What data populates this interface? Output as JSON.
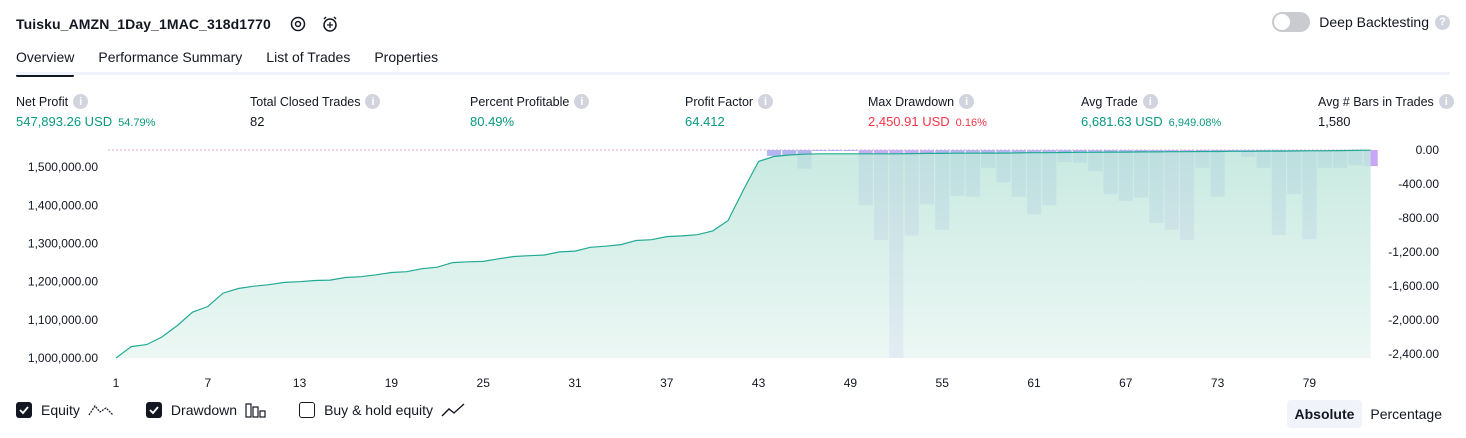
{
  "header": {
    "strategy_title": "Tuisku_AMZN_1Day_1MAC_318d1770",
    "settings_icon": "gear-icon",
    "add_alert_icon": "alarm-plus-icon",
    "deep_backtesting_label": "Deep Backtesting",
    "deep_backtesting_on": false
  },
  "tabs": [
    {
      "label": "Overview",
      "active": true
    },
    {
      "label": "Performance Summary",
      "active": false
    },
    {
      "label": "List of Trades",
      "active": false
    },
    {
      "label": "Properties",
      "active": false
    }
  ],
  "metrics": {
    "net_profit": {
      "label": "Net Profit",
      "value": "547,893.26 USD",
      "pct": "54.79%"
    },
    "total_closed_trades": {
      "label": "Total Closed Trades",
      "value": "82"
    },
    "percent_profitable": {
      "label": "Percent Profitable",
      "value": "80.49%"
    },
    "profit_factor": {
      "label": "Profit Factor",
      "value": "64.412"
    },
    "max_drawdown": {
      "label": "Max Drawdown",
      "value": "2,450.91 USD",
      "pct": "0.16%"
    },
    "avg_trade": {
      "label": "Avg Trade",
      "value": "6,681.63 USD",
      "pct": "6,949.08%"
    },
    "avg_bars": {
      "label": "Avg # Bars in Trades",
      "value": "1,580"
    }
  },
  "chart_data": {
    "type": "area",
    "x_ticks": [
      "1",
      "7",
      "13",
      "19",
      "25",
      "31",
      "37",
      "43",
      "49",
      "55",
      "61",
      "67",
      "73",
      "79"
    ],
    "y_left_ticks": [
      "1,500,000.00",
      "1,400,000.00",
      "1,300,000.00",
      "1,200,000.00",
      "1,100,000.00",
      "1,000,000.00"
    ],
    "y_right_ticks": [
      "0.00",
      "-400.00",
      "-800.00",
      "-1,200.00",
      "-1,600.00",
      "-2,000.00",
      "-2,400.00"
    ],
    "ylim_left": [
      1000000,
      1545000
    ],
    "ylim_right": [
      -2450,
      0
    ],
    "series": [
      {
        "name": "Equity",
        "color": "#22ab94",
        "x": [
          1,
          2,
          3,
          4,
          5,
          6,
          7,
          8,
          9,
          10,
          11,
          12,
          13,
          14,
          15,
          16,
          17,
          18,
          19,
          20,
          21,
          22,
          23,
          24,
          25,
          26,
          27,
          28,
          29,
          30,
          31,
          32,
          33,
          34,
          35,
          36,
          37,
          38,
          39,
          40,
          41,
          42,
          43,
          44,
          45,
          46,
          47,
          48,
          49,
          50,
          51,
          52,
          53,
          54,
          55,
          56,
          57,
          58,
          59,
          60,
          61,
          62,
          63,
          64,
          65,
          66,
          67,
          68,
          69,
          70,
          71,
          72,
          73,
          74,
          75,
          76,
          77,
          78,
          79,
          80,
          81,
          82,
          83
        ],
        "values": [
          1000000,
          1030000,
          1035000,
          1055000,
          1085000,
          1120000,
          1135000,
          1170000,
          1182000,
          1188000,
          1192000,
          1198000,
          1200000,
          1203000,
          1204000,
          1211000,
          1213000,
          1218000,
          1224000,
          1226000,
          1234000,
          1238000,
          1250000,
          1252000,
          1253000,
          1260000,
          1266000,
          1268000,
          1270000,
          1278000,
          1280000,
          1290000,
          1293000,
          1297000,
          1308000,
          1310000,
          1318000,
          1320000,
          1323000,
          1333000,
          1360000,
          1440000,
          1515000,
          1528000,
          1532000,
          1534000,
          1535000,
          1535000,
          1535000,
          1535000,
          1535000,
          1535000,
          1535500,
          1536000,
          1536000,
          1536500,
          1536500,
          1537000,
          1537000,
          1537500,
          1538000,
          1538000,
          1538500,
          1539000,
          1539000,
          1539500,
          1539500,
          1540000,
          1540000,
          1540500,
          1540500,
          1541000,
          1541000,
          1541500,
          1541500,
          1542000,
          1542000,
          1542500,
          1543000,
          1543000,
          1543500,
          1544000,
          1544500
        ]
      },
      {
        "name": "Drawdown",
        "color": "#b2b5f0",
        "x": [
          44,
          45,
          46,
          47,
          48,
          49,
          50,
          51,
          52,
          53,
          54,
          55,
          56,
          57,
          58,
          59,
          60,
          61,
          62,
          63,
          64,
          65,
          66,
          67,
          68,
          69,
          70,
          71,
          72,
          73,
          74,
          75,
          76,
          77,
          78,
          79,
          80,
          81,
          82,
          83
        ],
        "values": [
          -70,
          -60,
          -220,
          -10,
          -10,
          -10,
          -650,
          -1060,
          -2450,
          -1010,
          -640,
          -940,
          -540,
          -550,
          -210,
          -380,
          -550,
          -760,
          -650,
          -140,
          -150,
          -250,
          -520,
          -600,
          -560,
          -860,
          -940,
          -1060,
          -210,
          -550,
          -10,
          -80,
          -210,
          -1000,
          -520,
          -1050,
          -210,
          -210,
          -180,
          -190
        ]
      }
    ]
  },
  "legend": {
    "equity": {
      "label": "Equity",
      "checked": true,
      "icon": "equity-line-icon"
    },
    "drawdown": {
      "label": "Drawdown",
      "checked": true,
      "icon": "bars-icon"
    },
    "buy_hold": {
      "label": "Buy & hold equity",
      "checked": false,
      "icon": "trend-line-icon"
    }
  },
  "view_mode": {
    "absolute": "Absolute",
    "percentage": "Percentage",
    "selected": "absolute"
  },
  "colors": {
    "accent_green": "#089981",
    "accent_red": "#f23645",
    "drawdown_bar": "#b2b5f0",
    "equity_fill": "#d6efe9"
  }
}
